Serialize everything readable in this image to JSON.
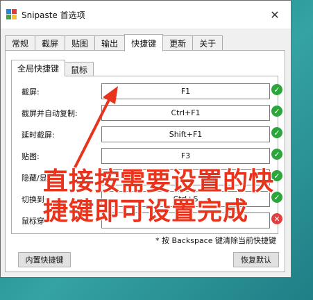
{
  "window": {
    "title": "Snipaste 首选项",
    "close_symbol": "✕"
  },
  "tabs": [
    {
      "label": "常规",
      "active": false
    },
    {
      "label": "截屏",
      "active": false
    },
    {
      "label": "贴图",
      "active": false
    },
    {
      "label": "输出",
      "active": false
    },
    {
      "label": "快捷键",
      "active": true
    },
    {
      "label": "更新",
      "active": false
    },
    {
      "label": "关于",
      "active": false
    }
  ],
  "subtabs": [
    {
      "label": "全局快捷键",
      "active": true
    },
    {
      "label": "鼠标",
      "active": false
    }
  ],
  "shortcuts": [
    {
      "label": "截屏:",
      "value": "F1",
      "status": "ok"
    },
    {
      "label": "截屏并自动复制:",
      "value": "Ctrl+F1",
      "status": "ok"
    },
    {
      "label": "延时截屏:",
      "value": "Shift+F1",
      "status": "ok"
    },
    {
      "label": "贴图:",
      "value": "F3",
      "status": "ok"
    },
    {
      "label": "隐藏/显",
      "value": "",
      "status": "ok"
    },
    {
      "label": "切换到",
      "value": "Ctrl+S",
      "status": "ok"
    },
    {
      "label": "鼠标穿",
      "value": "",
      "status": "error"
    }
  ],
  "note": "* 按 Backspace 键清除当前快捷键",
  "buttons": {
    "builtin": "内置快捷键",
    "restore": "恢复默认"
  },
  "overlay_text": "直接按需要设置的快捷键即可设置完成",
  "colors": {
    "ok": "#2aa63a",
    "error": "#e04040",
    "annotation": "#e8331d"
  }
}
